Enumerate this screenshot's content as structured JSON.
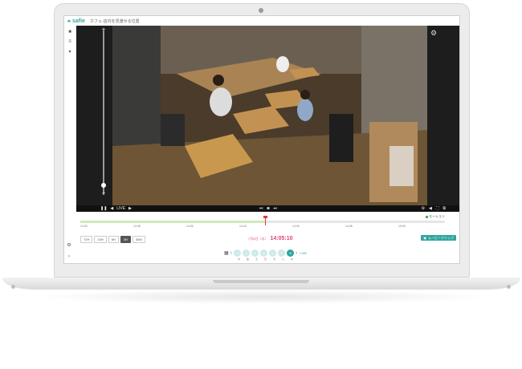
{
  "app": {
    "brand": "safie",
    "camera_title": "カフェ-店内を見渡せる位置"
  },
  "player": {
    "live_label": "LIVE",
    "zoom_in": "+",
    "zoom_out": "−",
    "zoom_level": 0.03
  },
  "timeline": {
    "motion_label": "モーション",
    "ticks": [
      "13:30",
      "13:45",
      "14:00",
      "14:15",
      "14:30",
      "14:45",
      "15:00"
    ],
    "cursor_fraction": 0.51
  },
  "range": {
    "buttons": [
      "72H",
      "24H",
      "6H",
      "3H",
      "30M"
    ],
    "active": "3H"
  },
  "datetime": {
    "date": "7月8日（水）",
    "time": "14:05:10"
  },
  "clip_button": "ムービークリップ",
  "days": {
    "numbers": [
      "2",
      "3",
      "4",
      "5",
      "6",
      "7",
      "8"
    ],
    "weekdays": [
      "木",
      "金",
      "土",
      "日",
      "月",
      "火",
      "水"
    ],
    "active_index": 6,
    "live_label": "LIVE"
  },
  "colors": {
    "accent": "#2fa59d",
    "datetime": "#e0457b",
    "cursor": "#e53935",
    "motion": "#4caf50"
  },
  "icons": [
    "camera-icon",
    "list-icon",
    "gear-icon",
    "play-icon",
    "pause-icon",
    "skip-back-icon",
    "skip-forward-icon",
    "volume-icon",
    "fullscreen-icon",
    "calendar-icon"
  ]
}
